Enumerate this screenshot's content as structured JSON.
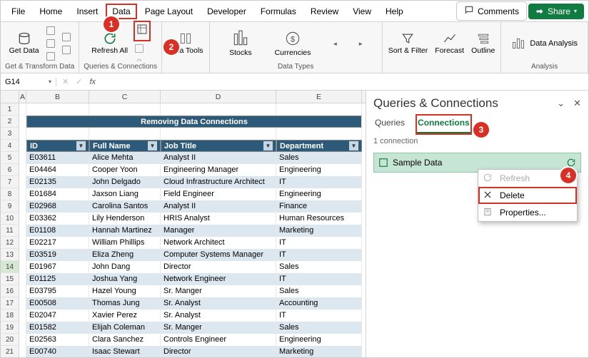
{
  "menu": {
    "file": "File",
    "home": "Home",
    "insert": "Insert",
    "data": "Data",
    "pagelayout": "Page Layout",
    "developer": "Developer",
    "formulas": "Formulas",
    "review": "Review",
    "view": "View",
    "help": "Help",
    "comments": "Comments",
    "share": "Share"
  },
  "ribbon": {
    "getdata": "Get\nData",
    "refreshall": "Refresh\nAll",
    "datatools": "Data\nTools",
    "stocks": "Stocks",
    "currencies": "Currencies",
    "sortfilter": "Sort &\nFilter",
    "forecast": "Forecast",
    "outline": "Outline",
    "dataanalysis": "Data Analysis",
    "g1": "Get & Transform Data",
    "g2": "Queries & Connections",
    "g3": "Data Types",
    "g4": "",
    "g5": "Analysis"
  },
  "fbar": {
    "name": "G14",
    "fx": "fx"
  },
  "cols": [
    "A",
    "B",
    "C",
    "D",
    "E"
  ],
  "title": "Removing Data Connections",
  "headers": {
    "id": "ID",
    "name": "Full Name",
    "job": "Job Title",
    "dept": "Department"
  },
  "rows": [
    {
      "n": 1
    },
    {
      "n": 2
    },
    {
      "n": 3
    },
    {
      "n": 4,
      "hdr": true
    },
    {
      "n": 5,
      "id": "E03611",
      "name": "Alice Mehta",
      "job": "Analyst II",
      "dept": "Sales",
      "b": 1
    },
    {
      "n": 6,
      "id": "E04464",
      "name": "Cooper Yoon",
      "job": "Engineering Manager",
      "dept": "Engineering",
      "b": 0
    },
    {
      "n": 7,
      "id": "E02135",
      "name": "John Delgado",
      "job": "Cloud Infrastructure Architect",
      "dept": "IT",
      "b": 1
    },
    {
      "n": 8,
      "id": "E01684",
      "name": "Jaxson Liang",
      "job": "Field Engineer",
      "dept": "Engineering",
      "b": 0
    },
    {
      "n": 9,
      "id": "E02968",
      "name": "Carolina Santos",
      "job": "Analyst II",
      "dept": "Finance",
      "b": 1
    },
    {
      "n": 10,
      "id": "E03362",
      "name": "Lily Henderson",
      "job": "HRIS Analyst",
      "dept": "Human Resources",
      "b": 0
    },
    {
      "n": 11,
      "id": "E01108",
      "name": "Hannah Martinez",
      "job": "Manager",
      "dept": "Marketing",
      "b": 1
    },
    {
      "n": 12,
      "id": "E02217",
      "name": "William Phillips",
      "job": "Network Architect",
      "dept": "IT",
      "b": 0
    },
    {
      "n": 13,
      "id": "E03519",
      "name": "Eliza Zheng",
      "job": "Computer Systems Manager",
      "dept": "IT",
      "b": 1
    },
    {
      "n": 14,
      "id": "E01967",
      "name": "John Dang",
      "job": "Director",
      "dept": "Sales",
      "b": 0,
      "sel": true
    },
    {
      "n": 15,
      "id": "E01125",
      "name": "Joshua Yang",
      "job": "Network Engineer",
      "dept": "IT",
      "b": 1
    },
    {
      "n": 16,
      "id": "E03795",
      "name": "Hazel Young",
      "job": "Sr. Manger",
      "dept": "Sales",
      "b": 0
    },
    {
      "n": 17,
      "id": "E00508",
      "name": "Thomas Jung",
      "job": "Sr. Analyst",
      "dept": "Accounting",
      "b": 1
    },
    {
      "n": 18,
      "id": "E02047",
      "name": "Xavier Perez",
      "job": "Sr. Analyst",
      "dept": "IT",
      "b": 0
    },
    {
      "n": 19,
      "id": "E01582",
      "name": "Elijah Coleman",
      "job": "Sr. Manger",
      "dept": "Sales",
      "b": 1
    },
    {
      "n": 20,
      "id": "E02563",
      "name": "Clara Sanchez",
      "job": "Controls Engineer",
      "dept": "Engineering",
      "b": 0
    },
    {
      "n": 21,
      "id": "E00740",
      "name": "Isaac Stewart",
      "job": "Director",
      "dept": "Marketing",
      "b": 1
    }
  ],
  "pane": {
    "title": "Queries & Connections",
    "tab_queries": "Queries",
    "tab_connections": "Connections",
    "count": "1 connection",
    "item": "Sample Data",
    "ctx_refresh": "Refresh",
    "ctx_delete": "Delete",
    "ctx_props": "Properties..."
  },
  "markers": {
    "1": "1",
    "2": "2",
    "3": "3",
    "4": "4"
  }
}
